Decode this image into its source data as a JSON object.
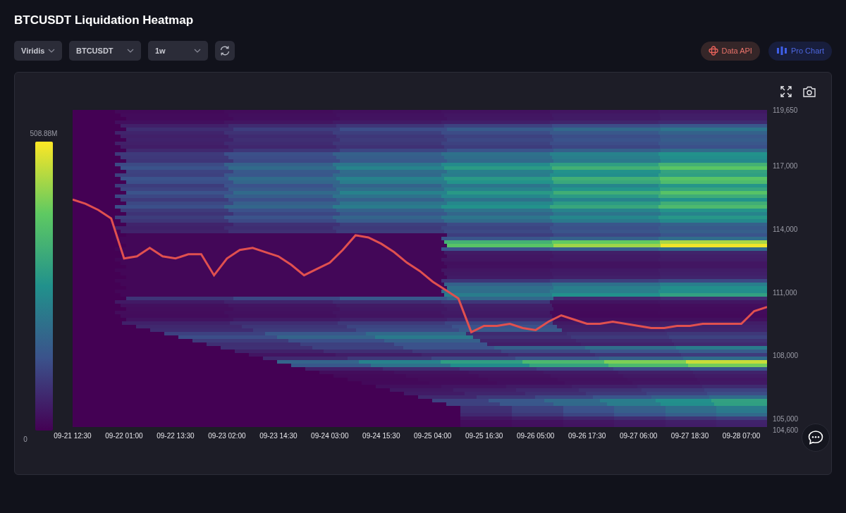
{
  "title": "BTCUSDT Liquidation Heatmap",
  "selects": [
    {
      "value": "Viridis"
    },
    {
      "value": "BTCUSDT"
    },
    {
      "value": "1w"
    }
  ],
  "links": [
    {
      "label": "Data API",
      "kind": "api"
    },
    {
      "label": "Pro Chart",
      "kind": "pro"
    }
  ],
  "heatmap": {
    "colorbar": {
      "max_label": "508.88M",
      "min_label": "0"
    },
    "chart_data": {
      "type": "line",
      "ylim": [
        104600,
        119650
      ],
      "categories": [
        "09-21 12:30",
        null,
        null,
        null,
        "09-22 01:00",
        null,
        null,
        null,
        "09-22 13:30",
        null,
        null,
        null,
        "09-23 02:00",
        null,
        null,
        null,
        "09-23 14:30",
        null,
        null,
        null,
        "09-24 03:00",
        null,
        null,
        null,
        "09-24 15:30",
        null,
        null,
        null,
        "09-25 04:00",
        null,
        null,
        null,
        "09-25 16:30",
        null,
        null,
        null,
        "09-26 05:00",
        null,
        null,
        null,
        "09-26 17:30",
        null,
        null,
        null,
        "09-27 06:00",
        null,
        null,
        null,
        "09-27 18:30",
        null,
        null,
        null,
        "09-28 07:00",
        null,
        null
      ],
      "series": [
        {
          "color": "#e0504f",
          "values": [
            115400,
            115200,
            114900,
            114500,
            112600,
            112700,
            113100,
            112700,
            112600,
            112800,
            112800,
            111800,
            112600,
            113000,
            113100,
            112900,
            112700,
            112300,
            111800,
            112100,
            112400,
            113000,
            113700,
            113600,
            113300,
            112900,
            112400,
            112000,
            111500,
            111100,
            110700,
            109100,
            109400,
            109400,
            109500,
            109300,
            109200,
            109600,
            109900,
            109700,
            109500,
            109500,
            109600,
            109500,
            109400,
            109300,
            109300,
            109400,
            109400,
            109500,
            109500,
            109500,
            109500,
            110100,
            110300
          ]
        }
      ],
      "yticks": [
        {
          "value": 119650,
          "label": "119,650"
        },
        {
          "value": 117000,
          "label": "117,000"
        },
        {
          "value": 114000,
          "label": "114,000"
        },
        {
          "value": 111000,
          "label": "111,000"
        },
        {
          "value": 108000,
          "label": "108,000"
        },
        {
          "value": 105000,
          "label": "105,000"
        },
        {
          "value": 104600,
          "label": "104,600"
        }
      ]
    }
  }
}
